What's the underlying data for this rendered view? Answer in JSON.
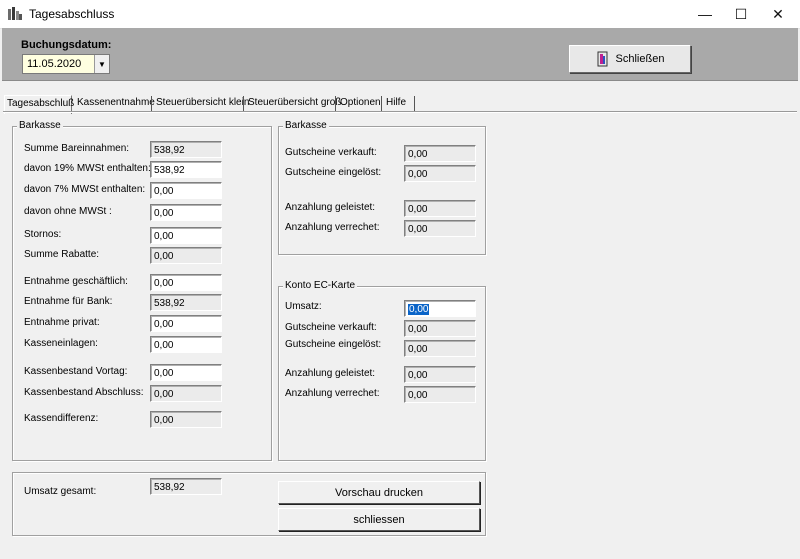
{
  "window": {
    "title": "Tagesabschluss",
    "controls": {
      "minimize": "—",
      "maximize": "☐",
      "close": "✕"
    }
  },
  "toolbar": {
    "date_label": "Buchungsdatum:",
    "date_value": "11.05.2020",
    "close_label": "Schließen"
  },
  "tabs": [
    "Tagesabschluß",
    "Kassenentnahme",
    "Steuerübersicht klein",
    "Steuerübersicht groß",
    "Optionen",
    "Hilfe"
  ],
  "barkasse_left": {
    "title": "Barkasse",
    "fields": [
      {
        "label": "Summe Bareinnahmen:",
        "value": "538,92"
      },
      {
        "label": "davon 19% MWSt enthalten:",
        "value": "538,92"
      },
      {
        "label": "davon 7% MWSt enthalten:",
        "value": "0,00"
      },
      {
        "label": "davon ohne  MWSt :",
        "value": "0,00"
      },
      {
        "label": "Stornos:",
        "value": "0,00"
      },
      {
        "label": "Summe Rabatte:",
        "value": "0,00"
      },
      {
        "label": "Entnahme geschäftlich:",
        "value": "0,00"
      },
      {
        "label": "Entnahme für Bank:",
        "value": "538,92"
      },
      {
        "label": "Entnahme privat:",
        "value": "0,00"
      },
      {
        "label": "Kasseneinlagen:",
        "value": "0,00"
      },
      {
        "label": "Kassenbestand Vortag:",
        "value": "0,00"
      },
      {
        "label": "Kassenbestand Abschluss:",
        "value": "0,00"
      },
      {
        "label": "Kassendifferenz:",
        "value": "0,00"
      }
    ]
  },
  "barkasse_right": {
    "title": "Barkasse",
    "fields": [
      {
        "label": "Gutscheine verkauft:",
        "value": "0,00"
      },
      {
        "label": "Gutscheine eingelöst:",
        "value": "0,00"
      },
      {
        "label": "Anzahlung geleistet:",
        "value": "0,00"
      },
      {
        "label": "Anzahlung verrechet:",
        "value": "0,00"
      }
    ]
  },
  "konto_ec": {
    "title": "Konto EC-Karte",
    "fields": [
      {
        "label": "Umsatz:",
        "value": "0,00"
      },
      {
        "label": "Gutscheine verkauft:",
        "value": "0,00"
      },
      {
        "label": "Gutscheine eingelöst:",
        "value": "0,00"
      },
      {
        "label": "Anzahlung geleistet:",
        "value": "0,00"
      },
      {
        "label": "Anzahlung verrechet:",
        "value": "0,00"
      }
    ]
  },
  "footer": {
    "umsatz_label": "Umsatz gesamt:",
    "umsatz_value": "538,92",
    "preview_label": "Vorschau drucken",
    "close_label": "schliessen"
  }
}
